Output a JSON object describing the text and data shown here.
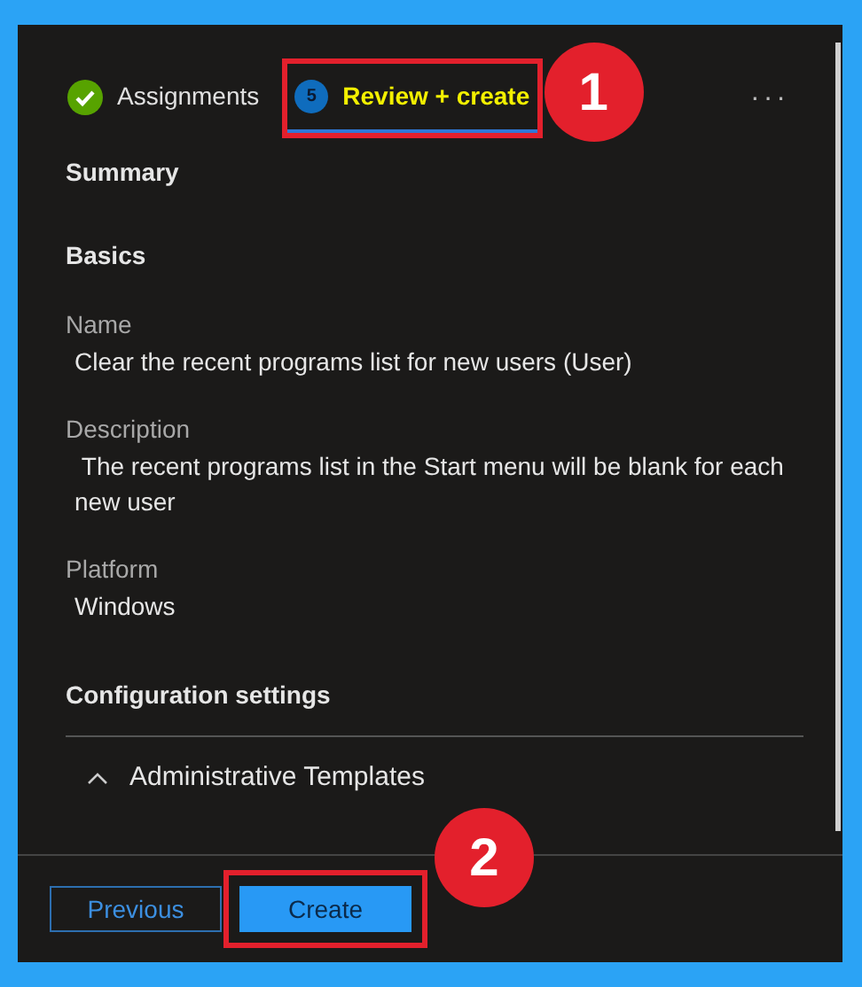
{
  "tabs": [
    {
      "label": "Assignments",
      "kind": "done",
      "selected": false
    },
    {
      "label": "Review + create",
      "kind": "step",
      "step": "5",
      "selected": true,
      "callout": "1"
    }
  ],
  "more": "···",
  "summary_title": "Summary",
  "sections": [
    {
      "heading": "Basics",
      "fields": [
        {
          "label": "Name",
          "value": "Clear the recent programs list for new users (User)"
        },
        {
          "label": "Description",
          "value": " The recent programs list in the Start menu will be blank for each new user"
        },
        {
          "label": "Platform",
          "value": "Windows"
        }
      ]
    }
  ],
  "config": {
    "heading": "Configuration settings",
    "group": {
      "label": "Administrative Templates",
      "expanded": true
    }
  },
  "footer": {
    "buttons": [
      {
        "label": "Previous",
        "kind": "secondary"
      },
      {
        "label": "Create",
        "kind": "primary",
        "callout": "2"
      }
    ]
  }
}
